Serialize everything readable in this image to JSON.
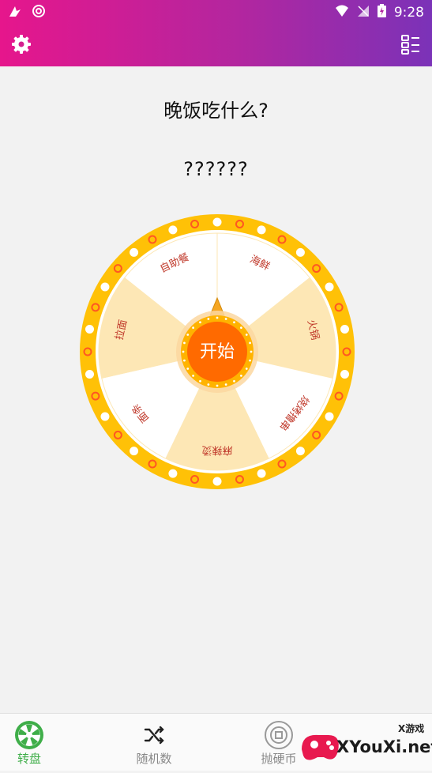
{
  "status_bar": {
    "time": "9:28"
  },
  "app_bar": {
    "settings_icon": "gear-icon",
    "list_icon": "list-icon"
  },
  "main": {
    "question": "晚饭吃什么?",
    "result": "??????"
  },
  "wheel": {
    "start_label": "开始",
    "segments": [
      "海鲜",
      "火锅",
      "烧烤撸串",
      "麻辣烫",
      "面条",
      "拉面",
      "自助餐"
    ],
    "colors": {
      "rim": "#ffc107",
      "segment_light": "#ffffff",
      "segment_dark": "#fde7b5",
      "text": "#c0392b",
      "center": "#ff6a00"
    }
  },
  "bottom_nav": {
    "items": [
      {
        "label": "转盘",
        "icon": "wheel-icon"
      },
      {
        "label": "随机数",
        "icon": "shuffle-icon"
      },
      {
        "label": "抛硬币",
        "icon": "coin-icon"
      }
    ],
    "active_color": "#3fae49"
  },
  "watermark": {
    "brand": "XYouXi.net",
    "tag": "X游戏"
  }
}
